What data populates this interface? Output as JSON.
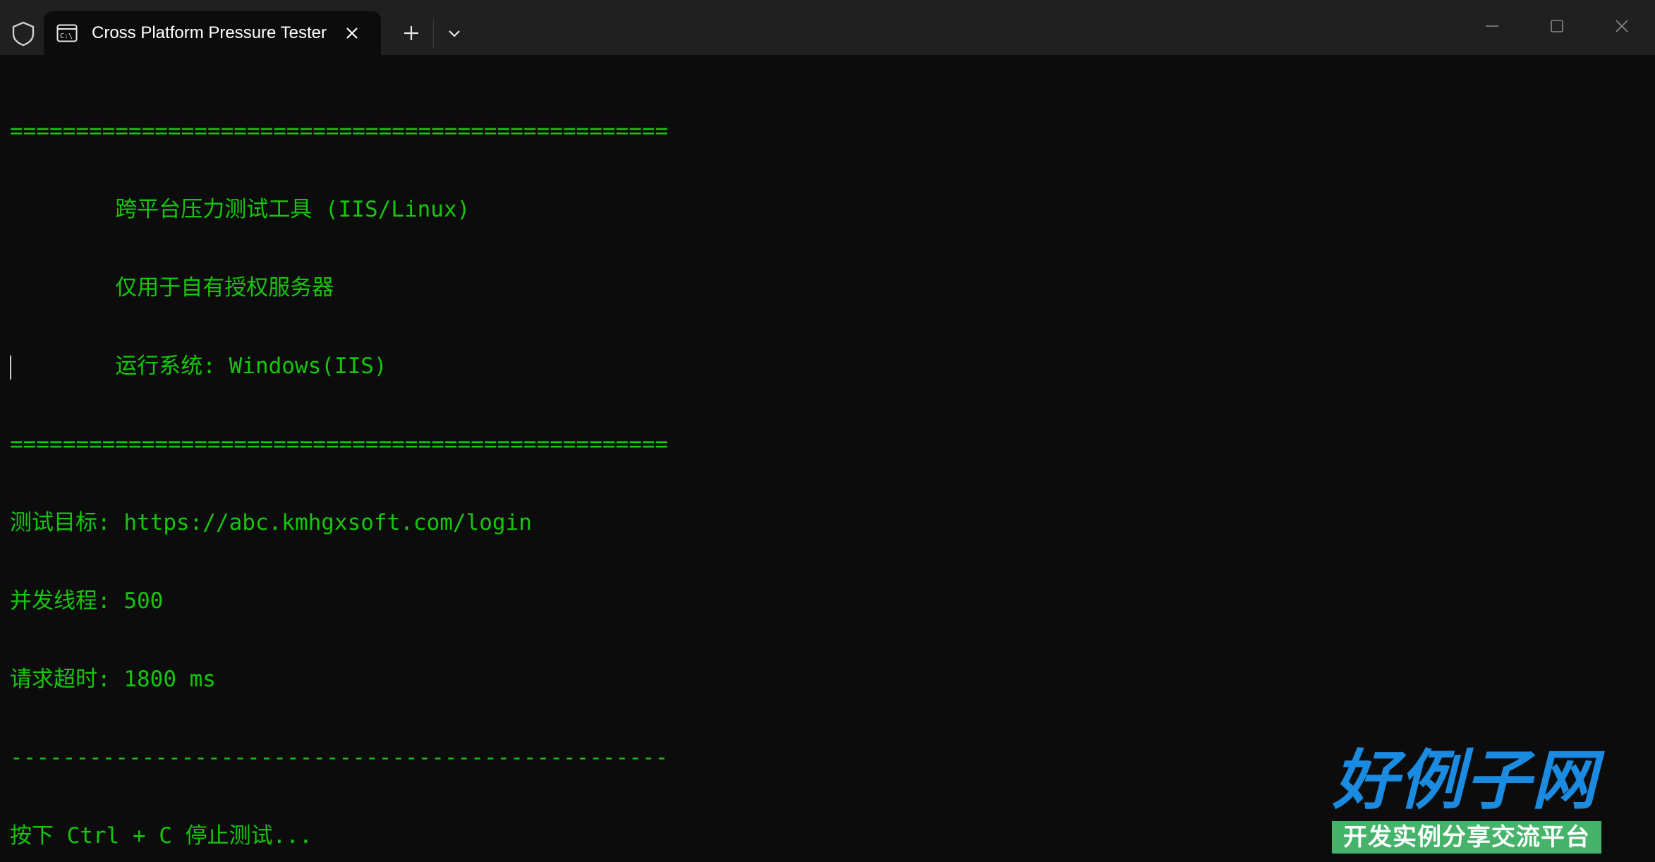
{
  "window": {
    "tab_title": "Cross Platform Pressure Tester",
    "icons": {
      "shield": "shield-icon",
      "terminal": "terminal-icon",
      "close": "close-icon",
      "plus": "plus-icon",
      "chevron": "chevron-down-icon",
      "minimize": "minimize-icon",
      "maximize": "maximize-icon",
      "window_close": "window-close-icon"
    }
  },
  "terminal": {
    "text_color": "#16c60c",
    "background": "#0c0c0c",
    "lines": [
      "==================================================",
      "        跨平台压力测试工具 (IIS/Linux)",
      "        仅用于自有授权服务器",
      "        运行系统: Windows(IIS)",
      "==================================================",
      "测试目标: https://abc.kmhgxsoft.com/login",
      "并发线程: 500",
      "请求超时: 1800 ms",
      "--------------------------------------------------",
      "按下 Ctrl + C 停止测试..."
    ]
  },
  "logo": {
    "main": "好例子网",
    "sub": "开发实例分享交流平台",
    "main_color": "#1a8be0",
    "sub_bg": "#46b36a"
  }
}
